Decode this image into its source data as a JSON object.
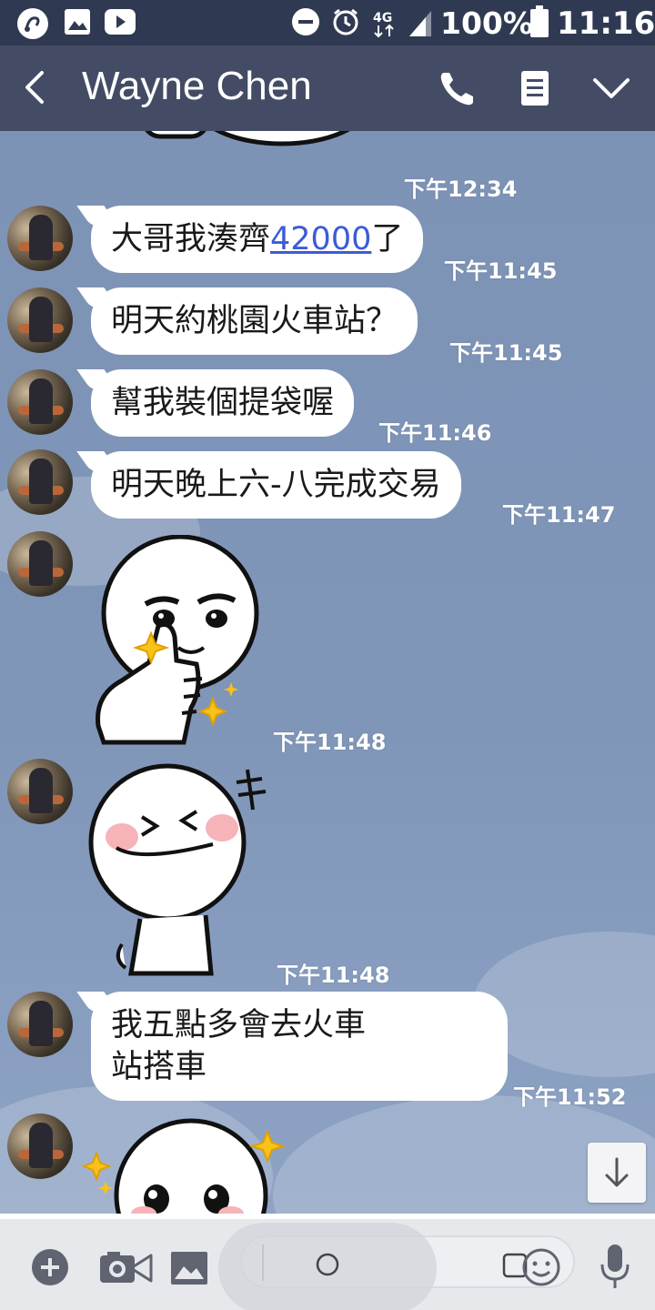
{
  "status_bar": {
    "network": "4G",
    "battery": "100%",
    "time": "11:16"
  },
  "header": {
    "contact_name": "Wayne Chen"
  },
  "messages": [
    {
      "kind": "sticker",
      "time": "下午12:34"
    },
    {
      "kind": "text",
      "text_before": "大哥我湊齊",
      "link": "42000",
      "text_after": "了",
      "time": "下午11:45"
    },
    {
      "kind": "text",
      "text": "明天約桃園火車站？",
      "time": "下午11:45"
    },
    {
      "kind": "text",
      "text": "幫我裝個提袋喔",
      "time": "下午11:46"
    },
    {
      "kind": "text",
      "text": "明天晚上六-八完成交易",
      "time": "下午11:47"
    },
    {
      "kind": "sticker",
      "time": "下午11:48"
    },
    {
      "kind": "sticker",
      "time": "下午11:48"
    },
    {
      "kind": "text",
      "line1": "我五點多會去火車",
      "line2": "站搭車",
      "time": "下午11:52"
    },
    {
      "kind": "sticker"
    }
  ],
  "colors": {
    "header": "#434c64",
    "status_bar": "#2f3a52",
    "chat_background": "#8096b9",
    "bubble": "#ffffff",
    "link": "#3d5bd8"
  }
}
